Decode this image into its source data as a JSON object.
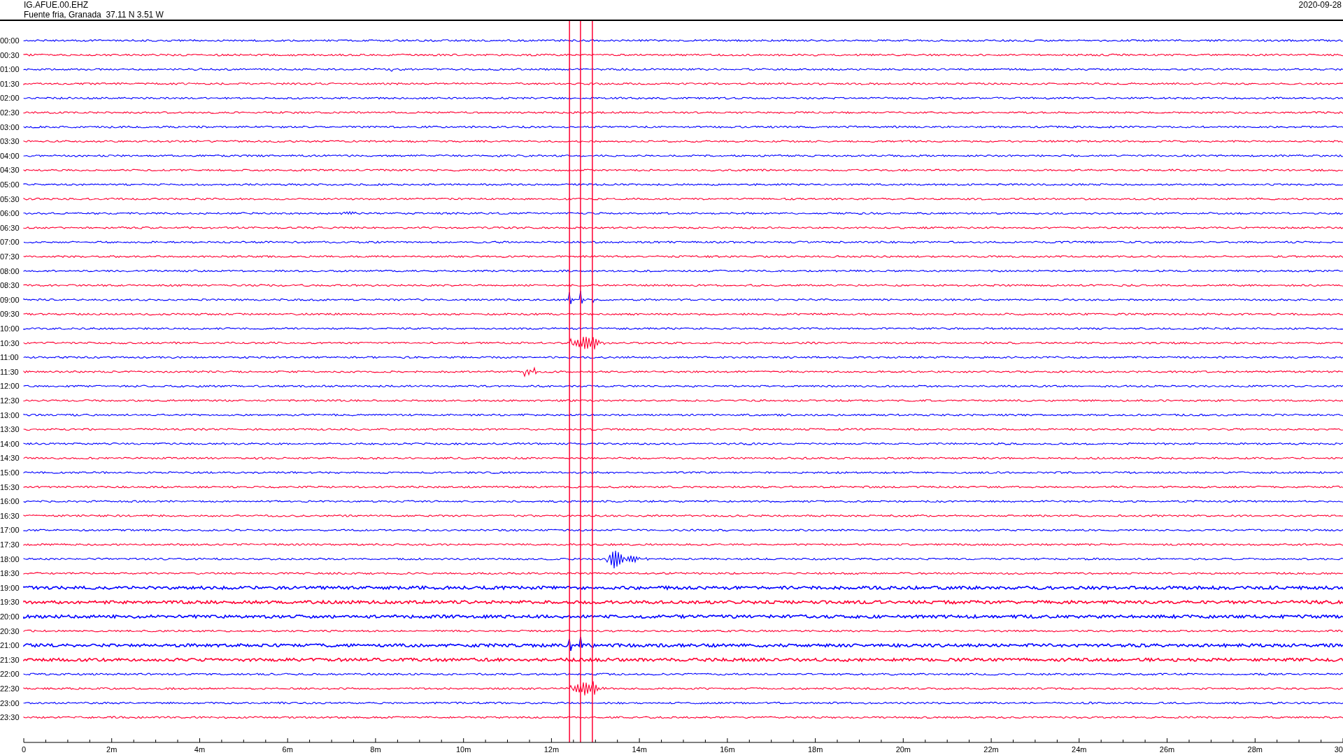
{
  "header": {
    "station": "IG.AFUE.00.EHZ",
    "location": "Fuente fria, Granada  37.11 N 3.51 W",
    "date": "2020-09-28"
  },
  "rows": [
    {
      "label": "00:00",
      "color": "#0000ff"
    },
    {
      "label": "00:30",
      "color": "#ff0033"
    },
    {
      "label": "01:00",
      "color": "#0000ff"
    },
    {
      "label": "01:30",
      "color": "#ff0033"
    },
    {
      "label": "02:00",
      "color": "#0000ff"
    },
    {
      "label": "02:30",
      "color": "#ff0033"
    },
    {
      "label": "03:00",
      "color": "#0000ff"
    },
    {
      "label": "03:30",
      "color": "#ff0033"
    },
    {
      "label": "04:00",
      "color": "#0000ff"
    },
    {
      "label": "04:30",
      "color": "#ff0033"
    },
    {
      "label": "05:00",
      "color": "#0000ff"
    },
    {
      "label": "05:30",
      "color": "#ff0033"
    },
    {
      "label": "06:00",
      "color": "#0000ff"
    },
    {
      "label": "06:30",
      "color": "#ff0033"
    },
    {
      "label": "07:00",
      "color": "#0000ff"
    },
    {
      "label": "07:30",
      "color": "#ff0033"
    },
    {
      "label": "08:00",
      "color": "#0000ff"
    },
    {
      "label": "08:30",
      "color": "#ff0033"
    },
    {
      "label": "09:00",
      "color": "#0000ff"
    },
    {
      "label": "09:30",
      "color": "#ff0033"
    },
    {
      "label": "10:00",
      "color": "#0000ff"
    },
    {
      "label": "10:30",
      "color": "#ff0033"
    },
    {
      "label": "11:00",
      "color": "#0000ff"
    },
    {
      "label": "11:30",
      "color": "#ff0033"
    },
    {
      "label": "12:00",
      "color": "#0000ff"
    },
    {
      "label": "12:30",
      "color": "#ff0033"
    },
    {
      "label": "13:00",
      "color": "#0000ff"
    },
    {
      "label": "13:30",
      "color": "#ff0033"
    },
    {
      "label": "14:00",
      "color": "#0000ff"
    },
    {
      "label": "14:30",
      "color": "#ff0033"
    },
    {
      "label": "15:00",
      "color": "#0000ff"
    },
    {
      "label": "15:30",
      "color": "#ff0033"
    },
    {
      "label": "16:00",
      "color": "#0000ff"
    },
    {
      "label": "16:30",
      "color": "#ff0033"
    },
    {
      "label": "17:00",
      "color": "#0000ff"
    },
    {
      "label": "17:30",
      "color": "#ff0033"
    },
    {
      "label": "18:00",
      "color": "#0000ff"
    },
    {
      "label": "18:30",
      "color": "#ff0033"
    },
    {
      "label": "19:00",
      "color": "#0000ff"
    },
    {
      "label": "19:30",
      "color": "#ff0033"
    },
    {
      "label": "20:00",
      "color": "#0000ff"
    },
    {
      "label": "20:30",
      "color": "#ff0033"
    },
    {
      "label": "21:00",
      "color": "#0000ff"
    },
    {
      "label": "21:30",
      "color": "#ff0033"
    },
    {
      "label": "22:00",
      "color": "#0000ff"
    },
    {
      "label": "22:30",
      "color": "#ff0033"
    },
    {
      "label": "23:00",
      "color": "#0000ff"
    },
    {
      "label": "23:30",
      "color": "#ff0033"
    }
  ],
  "x_axis": {
    "ticks": [
      "0",
      "2m",
      "4m",
      "6m",
      "8m",
      "10m",
      "12m",
      "14m",
      "16m",
      "18m",
      "20m",
      "22m",
      "24m",
      "26m",
      "28m",
      "30"
    ]
  }
}
